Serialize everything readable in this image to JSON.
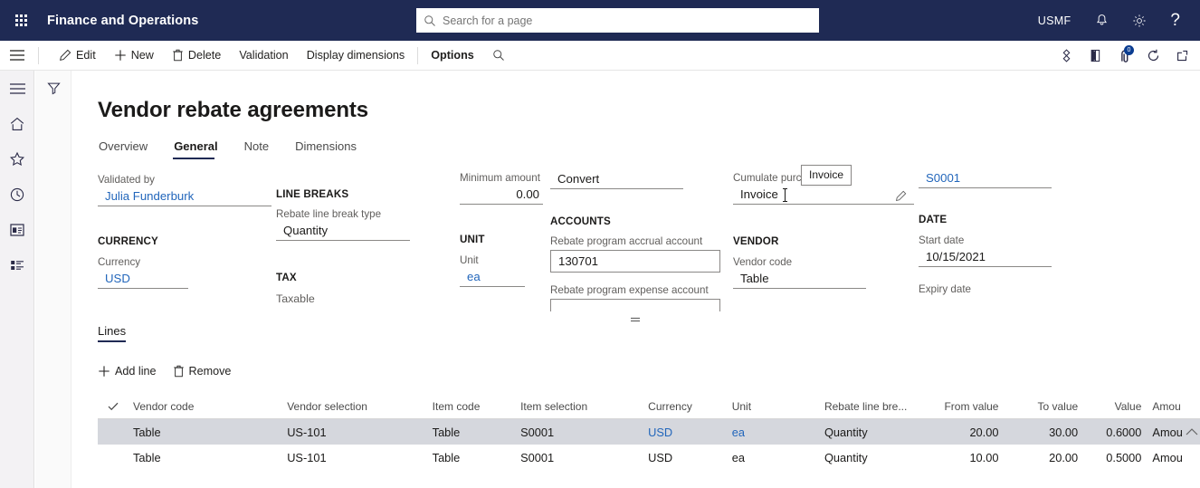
{
  "topbar": {
    "waffle_icon": "app-launcher-icon",
    "app_title": "Finance and Operations",
    "search_placeholder": "Search for a page",
    "search_value": "",
    "search_icon": "search-icon",
    "company": "USMF",
    "notifications_icon": "bell-icon",
    "settings_icon": "gear-icon",
    "help_label": "?"
  },
  "commandbar": {
    "menu_icon": "hamburger-icon",
    "buttons": [
      {
        "label": "Edit",
        "icon": "pencil-icon",
        "bold": false
      },
      {
        "label": "New",
        "icon": "plus-icon",
        "bold": false
      },
      {
        "label": "Delete",
        "icon": "trash-icon",
        "bold": false
      },
      {
        "label": "Validation",
        "icon": "",
        "bold": false
      },
      {
        "label": "Display dimensions",
        "icon": "",
        "bold": false
      },
      {
        "label": "Options",
        "icon": "",
        "bold": true
      }
    ],
    "search_icon": "search-icon",
    "right_icons": [
      {
        "name": "share-icon"
      },
      {
        "name": "office-app-icon"
      },
      {
        "name": "attachment-icon",
        "badge": "0"
      },
      {
        "name": "refresh-icon"
      },
      {
        "name": "open-in-new-window-icon"
      }
    ]
  },
  "rail": {
    "items": [
      {
        "name": "hamburger-icon"
      },
      {
        "name": "home-icon"
      },
      {
        "name": "favorites-star-icon"
      },
      {
        "name": "recent-clock-icon"
      },
      {
        "name": "workspaces-icon"
      },
      {
        "name": "modules-list-icon"
      }
    ]
  },
  "filterpane": {
    "filter_icon": "filter-icon"
  },
  "page": {
    "title": "Vendor rebate agreements",
    "tabs": [
      {
        "label": "Overview",
        "active": false
      },
      {
        "label": "General",
        "active": true
      },
      {
        "label": "Note",
        "active": false
      },
      {
        "label": "Dimensions",
        "active": false
      }
    ]
  },
  "form": {
    "validated_by_label": "Validated by",
    "validated_by_value": "Julia Funderburk",
    "currency_group": "CURRENCY",
    "currency_label": "Currency",
    "currency_value": "USD",
    "line_breaks_group": "LINE BREAKS",
    "rebate_line_break_type_label": "Rebate line break type",
    "rebate_line_break_type_value": "Quantity",
    "tax_group": "TAX",
    "taxable_label": "Taxable",
    "minimum_amount_label": "Minimum amount",
    "minimum_amount_value": "0.00",
    "unit_group": "UNIT",
    "unit_label": "Unit",
    "unit_value": "ea",
    "convert_value": "Convert",
    "accounts_group": "ACCOUNTS",
    "accrual_account_label": "Rebate program accrual account",
    "accrual_account_value": "130701",
    "expense_account_label": "Rebate program expense account",
    "expense_account_value": "",
    "cumulate_purchase_label": "Cumulate purch",
    "cumulate_purchase_value": "Invoice",
    "cumulate_tooltip": "Invoice",
    "edit_pencil_icon": "pencil-icon",
    "vendor_group": "VENDOR",
    "vendor_code_label": "Vendor code",
    "vendor_code_value": "Table",
    "agreement_id_value": "S0001",
    "date_group": "DATE",
    "start_date_label": "Start date",
    "start_date_value": "10/15/2021",
    "expiry_date_label": "Expiry date",
    "expiry_date_value": ""
  },
  "lines": {
    "tab_label": "Lines",
    "add_line_label": "Add line",
    "add_line_icon": "plus-icon",
    "remove_label": "Remove",
    "remove_icon": "trash-icon",
    "select_all_icon": "checkmark-icon",
    "columns": [
      "Vendor code",
      "Vendor selection",
      "Item code",
      "Item selection",
      "Currency",
      "Unit",
      "Rebate line bre...",
      "From value",
      "To value",
      "Value",
      "Amou"
    ],
    "rows": [
      {
        "selected": true,
        "vendor_code": "Table",
        "vendor_selection": "US-101",
        "item_code": "Table",
        "item_selection": "S0001",
        "currency": "USD",
        "unit": "ea",
        "rebate_line_break": "Quantity",
        "from_value": "20.00",
        "to_value": "30.00",
        "value": "0.6000",
        "amount": "Amou",
        "chevron_icon": "chevron-up-icon"
      },
      {
        "selected": false,
        "vendor_code": "Table",
        "vendor_selection": "US-101",
        "item_code": "Table",
        "item_selection": "S0001",
        "currency": "USD",
        "unit": "ea",
        "rebate_line_break": "Quantity",
        "from_value": "10.00",
        "to_value": "20.00",
        "value": "0.5000",
        "amount": "Amou"
      }
    ]
  },
  "colors": {
    "header_navy": "#1f2a54",
    "link_blue": "#2266bb",
    "selected_row": "#d5d7dd",
    "rail_bg": "#f3f2f4"
  }
}
